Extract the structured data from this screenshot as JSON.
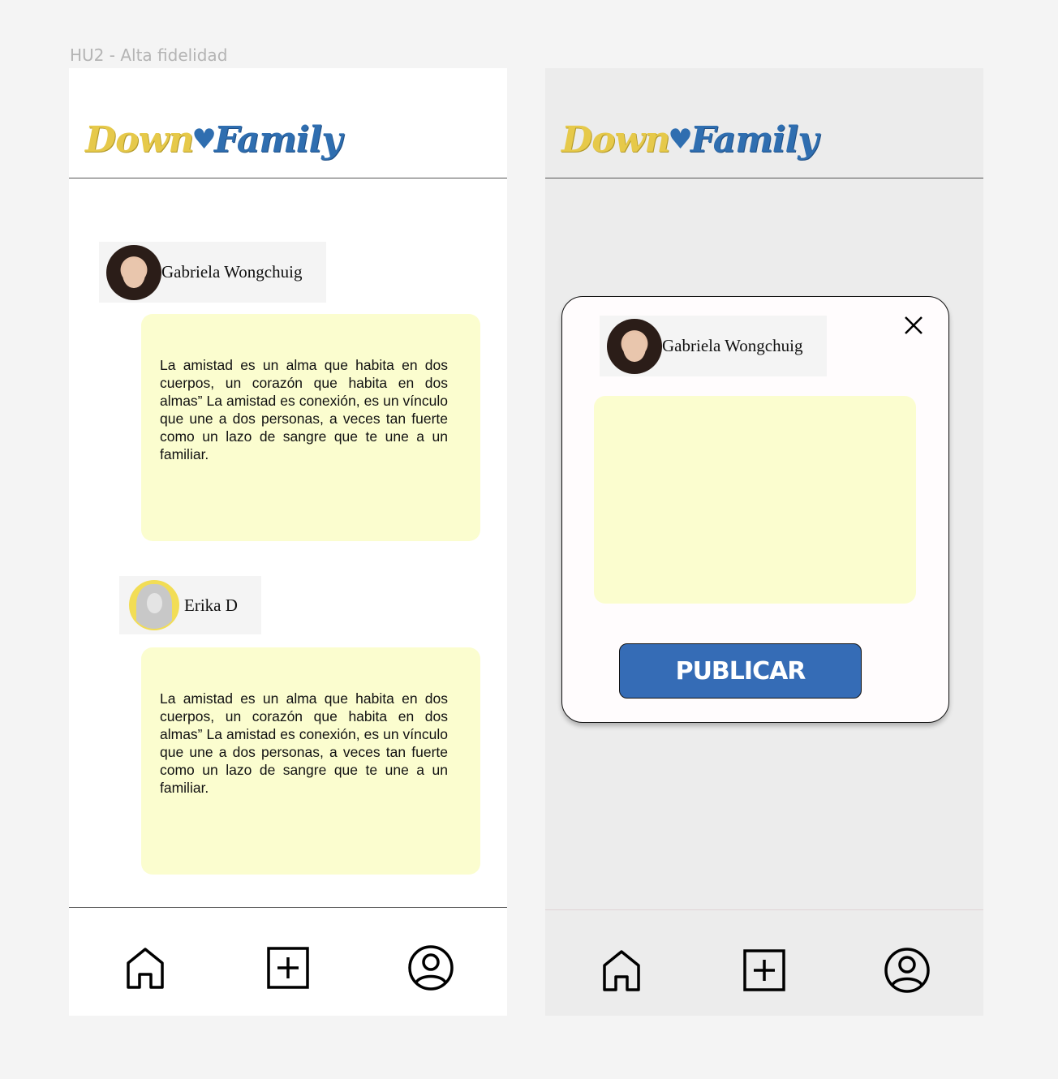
{
  "frame_label": "HU2 - Alta fidelidad",
  "app": {
    "logo_word_1": "Down",
    "logo_word_2": "Family",
    "logo_colors": {
      "yellow": "#e6c94a",
      "blue": "#2f6eb0"
    }
  },
  "feed": {
    "posts": [
      {
        "author": "Gabriela Wongchuig",
        "text": "La amistad es un alma que habita en dos cuerpos, un corazón que habita en dos almas” La amistad es conexión, es un vínculo que une a dos personas, a veces tan fuerte como un lazo de sangre que te une a un familiar."
      },
      {
        "author": "Erika D",
        "text": "La amistad es un alma que habita en dos cuerpos, un corazón que habita en dos almas” La amistad es conexión, es un vínculo que une a dos personas, a veces tan fuerte como un lazo de sangre que te une a un familiar."
      }
    ]
  },
  "modal": {
    "author": "Gabriela Wongchuig",
    "compose_value": "",
    "publish_label": "PUBLICAR",
    "publish_color": "#356cb6",
    "card_color": "#fbfdcf"
  },
  "nav": {
    "items": [
      {
        "icon": "home-icon"
      },
      {
        "icon": "add-square-icon"
      },
      {
        "icon": "user-circle-icon"
      }
    ]
  }
}
